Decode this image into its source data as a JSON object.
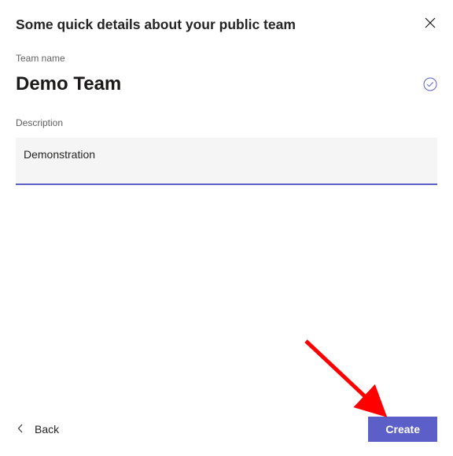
{
  "dialog": {
    "title": "Some quick details about your public team"
  },
  "fields": {
    "name_label": "Team name",
    "name_value": "Demo Team",
    "description_label": "Description",
    "description_value": "Demonstration"
  },
  "buttons": {
    "back": "Back",
    "create": "Create"
  },
  "colors": {
    "accent": "#5b5fc7",
    "arrow": "#ff0000"
  }
}
